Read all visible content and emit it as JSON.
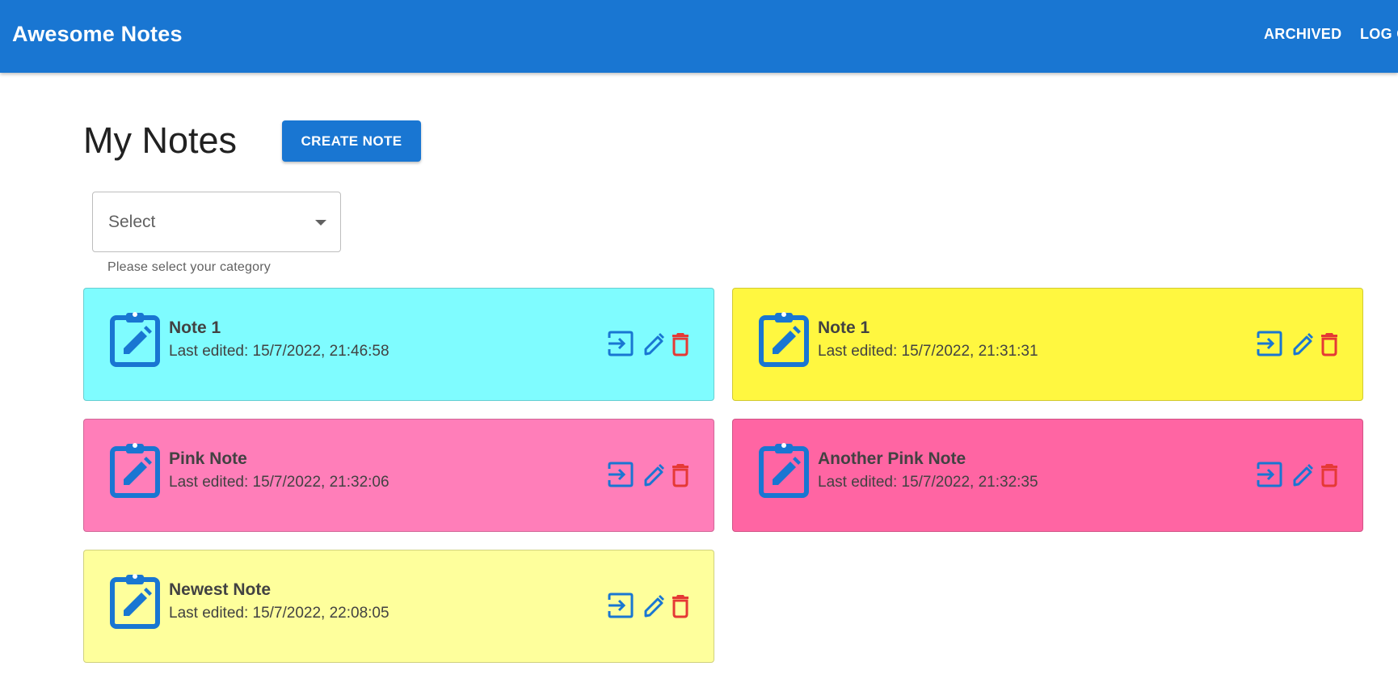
{
  "appbar": {
    "title": "Awesome Notes",
    "nav": {
      "archived_label": "ARCHIVED",
      "logout_label": "LOG OUT"
    },
    "color": "#1976d2"
  },
  "main": {
    "title": "My Notes",
    "create_label": "CREATE NOTE",
    "category_select": {
      "value": "Select",
      "helper": "Please select your category"
    }
  },
  "icons": {
    "note": "clipboard-edit-icon",
    "open": "open-in-icon",
    "edit": "pencil-icon",
    "delete": "trash-icon"
  },
  "colors": {
    "primary": "#1976d2",
    "delete": "#e53935"
  },
  "notes": [
    {
      "title": "Note 1",
      "last_edited": "Last edited: 15/7/2022, 21:46:58",
      "color": "#7ffcff"
    },
    {
      "title": "Note 1",
      "last_edited": "Last edited: 15/7/2022, 21:31:31",
      "color": "#fff740"
    },
    {
      "title": "Pink Note",
      "last_edited": "Last edited: 15/7/2022, 21:32:06",
      "color": "#ff7eb9"
    },
    {
      "title": "Another Pink Note",
      "last_edited": "Last edited: 15/7/2022, 21:32:35",
      "color": "#ff65a3"
    },
    {
      "title": "Newest Note",
      "last_edited": "Last edited: 15/7/2022, 22:08:05",
      "color": "#feff9c"
    }
  ]
}
